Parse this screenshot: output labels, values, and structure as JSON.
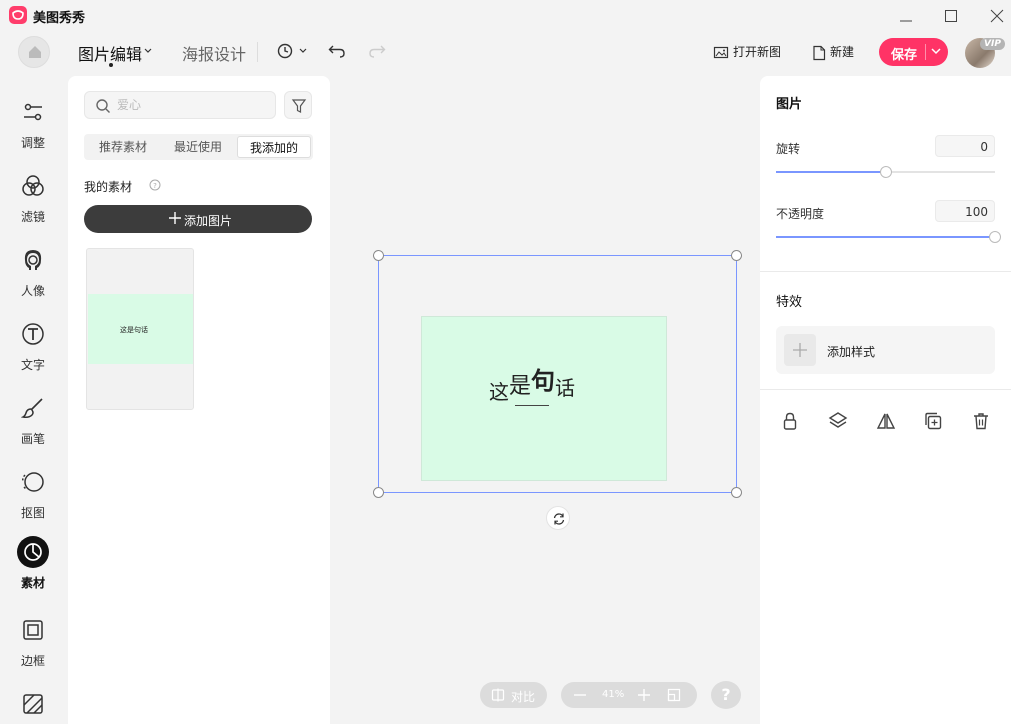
{
  "app": {
    "name": "美图秀秀"
  },
  "header": {
    "tabs": [
      {
        "label": "图片编辑",
        "active": true
      },
      {
        "label": "海报设计",
        "active": false
      }
    ],
    "open_new_label": "打开新图",
    "new_label": "新建",
    "save_label": "保存",
    "vip_badge": "VIP"
  },
  "sidebar": {
    "items": [
      {
        "label": "调整",
        "icon": "sliders-icon"
      },
      {
        "label": "滤镜",
        "icon": "filter-circles-icon"
      },
      {
        "label": "人像",
        "icon": "portrait-icon"
      },
      {
        "label": "文字",
        "icon": "text-icon"
      },
      {
        "label": "画笔",
        "icon": "brush-icon"
      },
      {
        "label": "抠图",
        "icon": "cutout-icon"
      },
      {
        "label": "素材",
        "icon": "sticker-icon",
        "active": true
      },
      {
        "label": "边框",
        "icon": "frame-icon"
      },
      {
        "label": "",
        "icon": "pattern-icon"
      }
    ]
  },
  "material_panel": {
    "search_placeholder": "爱心",
    "tabs": [
      {
        "label": "推荐素材",
        "active": false
      },
      {
        "label": "最近使用",
        "active": false
      },
      {
        "label": "我添加的",
        "active": true
      }
    ],
    "section_title": "我的素材",
    "add_image_label": "添加图片",
    "thumbnail_text": "这是句话"
  },
  "canvas": {
    "image_text": [
      "这",
      "是",
      "句",
      "话"
    ],
    "compare_label": "对比",
    "zoom_value": "41%",
    "help_label": "?"
  },
  "properties": {
    "title": "图片",
    "rotate_label": "旋转",
    "rotate_value": "0",
    "rotate_fraction": 0.5,
    "opacity_label": "不透明度",
    "opacity_value": "100",
    "opacity_fraction": 1.0,
    "effects_title": "特效",
    "add_style_label": "添加样式",
    "tools": [
      "lock-icon",
      "layers-icon",
      "flip-icon",
      "duplicate-icon",
      "trash-icon"
    ]
  },
  "colors": {
    "accent": "#ff3366",
    "selection": "#7a96ff",
    "image_bg": "#d9fbe6",
    "dark_button": "#3c3c3c"
  }
}
